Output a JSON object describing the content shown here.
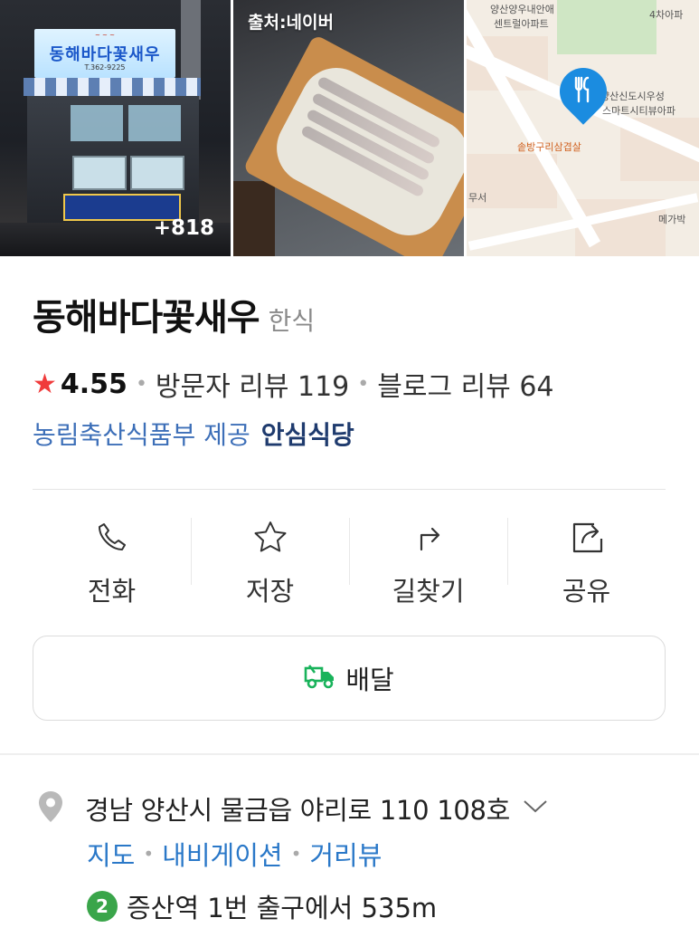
{
  "photos": {
    "storefront": {
      "sign_title": "동해바다꽃새우",
      "sign_tel": "T.362-9225",
      "more_count": "+818"
    },
    "food": {
      "source_label": "출처:네이버"
    },
    "map": {
      "labels": [
        "양산양우내안애",
        "센트럴아파트",
        "4차아파",
        "양산신도시우성",
        "스마트시티뷰아파",
        "솥방구리삼겹살",
        "무서",
        "메가박"
      ]
    }
  },
  "place": {
    "name": "동해바다꽃새우",
    "category": "한식",
    "rating": "4.55",
    "visitor_reviews": "방문자 리뷰 119",
    "blog_reviews": "블로그 리뷰 64",
    "provider": "농림축산식품부 제공",
    "safe_badge": "안심식당"
  },
  "actions": [
    {
      "label": "전화",
      "icon": "phone-icon"
    },
    {
      "label": "저장",
      "icon": "star-icon"
    },
    {
      "label": "길찾기",
      "icon": "directions-icon"
    },
    {
      "label": "공유",
      "icon": "share-icon"
    }
  ],
  "delivery": {
    "label": "배달",
    "icon": "delivery-truck-icon",
    "icon_color": "#19b35b"
  },
  "address": {
    "text": "경남 양산시 물금읍 야리로 110 108호",
    "links": [
      "지도",
      "내비게이션",
      "거리뷰"
    ],
    "subway_line": "2",
    "subway_line_color": "#3aa54a",
    "subway_text": "증산역 1번 출구에서 535m"
  },
  "colors": {
    "star": "#f03b3b",
    "link": "#2a78c8",
    "provider": "#3d6fb8",
    "map_pin": "#1b8ce0"
  }
}
